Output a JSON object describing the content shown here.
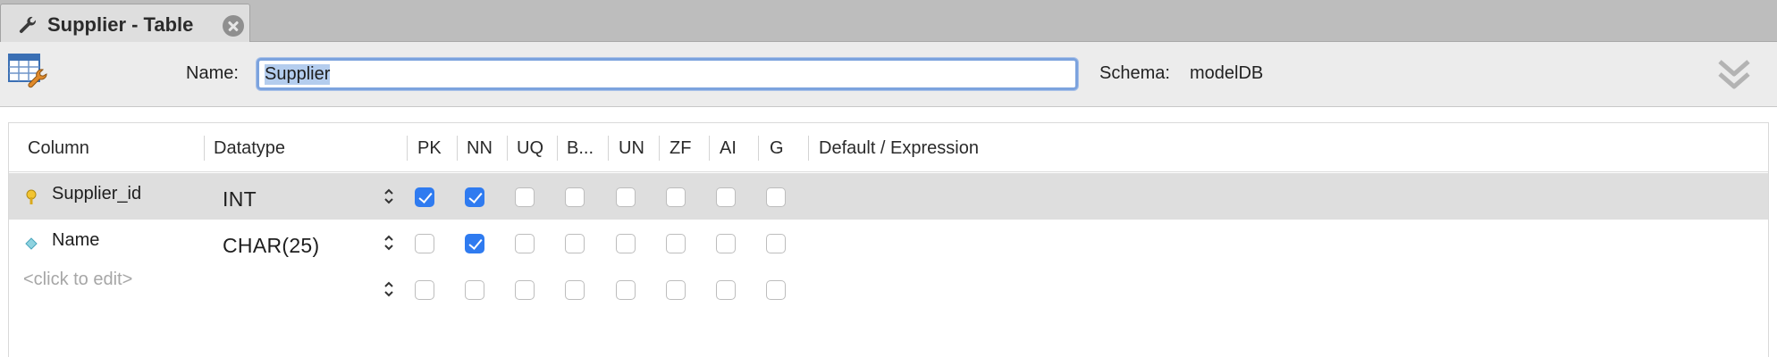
{
  "tab": {
    "title": "Supplier - Table",
    "icon": "wrench-icon",
    "close_icon": "close-icon"
  },
  "header": {
    "name_label": "Name:",
    "name_value": "Supplier",
    "schema_label": "Schema:",
    "schema_value": "modelDB",
    "collapse_icon": "double-chevron-down-icon",
    "selection_color": "#b4cdee",
    "focus_color": "#7ca3de"
  },
  "grid": {
    "columns": [
      "Column",
      "Datatype",
      "PK",
      "NN",
      "UQ",
      "B...",
      "UN",
      "ZF",
      "AI",
      "G",
      "Default / Expression"
    ],
    "rows": [
      {
        "name": "Supplier_id",
        "icon": "primary-key-icon",
        "type": "INT",
        "selected": true,
        "flags": [
          true,
          true,
          false,
          false,
          false,
          false,
          false,
          false
        ]
      },
      {
        "name": "Name",
        "icon": "column-diamond-icon",
        "type": "CHAR(25)",
        "selected": false,
        "flags": [
          false,
          true,
          false,
          false,
          false,
          false,
          false,
          false
        ]
      },
      {
        "name": "<click to edit>",
        "icon": "",
        "type": "",
        "selected": false,
        "flags": [
          false,
          false,
          false,
          false,
          false,
          false,
          false,
          false
        ]
      }
    ],
    "checkbox_color": "#2f7bf0",
    "selected_row_color": "#dedede"
  }
}
